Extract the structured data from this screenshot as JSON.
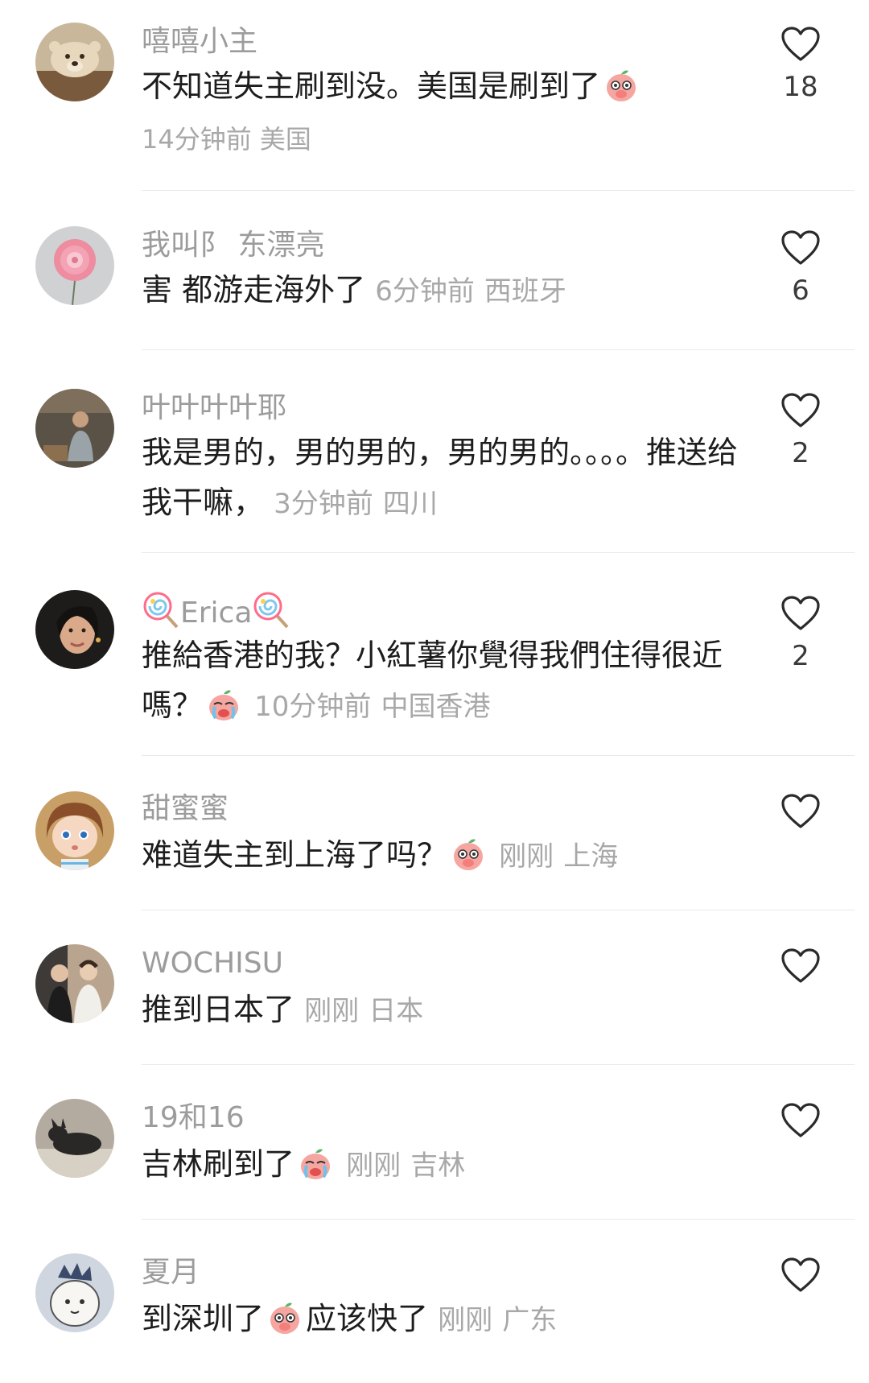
{
  "comments": [
    {
      "username": "嘻嘻小主",
      "text": "不知道失主刷到没。美国是刷到了",
      "emoji": "shy-peach-emoji",
      "time": "14分钟前",
      "location": "美国",
      "likes": "18",
      "avatar": "bear-avatar"
    },
    {
      "username": "我叫阝 东漂亮",
      "text": "害  都游走海外了",
      "time": "6分钟前",
      "location": "西班牙",
      "likes": "6",
      "avatar": "flower-avatar"
    },
    {
      "username": "叶叶叶叶耶",
      "text": "我是男的，男的男的，男的男的。。。。推送给我干嘛，",
      "time": "3分钟前",
      "location": "四川",
      "likes": "2",
      "avatar": "man-sitting-avatar"
    },
    {
      "username": "Erica",
      "username_prefix_emoji": "lollipop-emoji",
      "username_suffix_emoji": "lollipop-emoji",
      "text_line1": "推給香港的我？小紅薯你覺得我們住得很近",
      "text_line2": "嗎？",
      "emoji": "crying-peach-emoji",
      "time": "10分钟前",
      "location": "中国香港",
      "likes": "2",
      "avatar": "woman-avatar"
    },
    {
      "username": "甜蜜蜜",
      "text": "难道失主到上海了吗？",
      "emoji": "shy-peach-emoji",
      "time": "刚刚",
      "location": "上海",
      "likes": "",
      "avatar": "cartoon-girl-avatar"
    },
    {
      "username": "WOCHISU",
      "text": "推到日本了",
      "time": "刚刚",
      "location": "日本",
      "likes": "",
      "avatar": "two-people-avatar"
    },
    {
      "username": "19和16",
      "text": "吉林刷到了",
      "emoji": "crying-peach-emoji",
      "time": "刚刚",
      "location": "吉林",
      "likes": "",
      "avatar": "dog-avatar"
    },
    {
      "username": "夏月",
      "text_part1": "到深圳了",
      "emoji": "shy-peach-emoji",
      "text_part2": "应该快了",
      "time": "刚刚",
      "location": "广东",
      "likes": "",
      "avatar": "cartoon-character-avatar"
    }
  ],
  "colors": {
    "username": "#9c9c9c",
    "text": "#1d1d1d",
    "meta": "#a8a8a8",
    "divider": "#e9e9e9",
    "heart_outline": "#2b2b2b"
  },
  "icons": {
    "like": "heart-outline-icon"
  }
}
